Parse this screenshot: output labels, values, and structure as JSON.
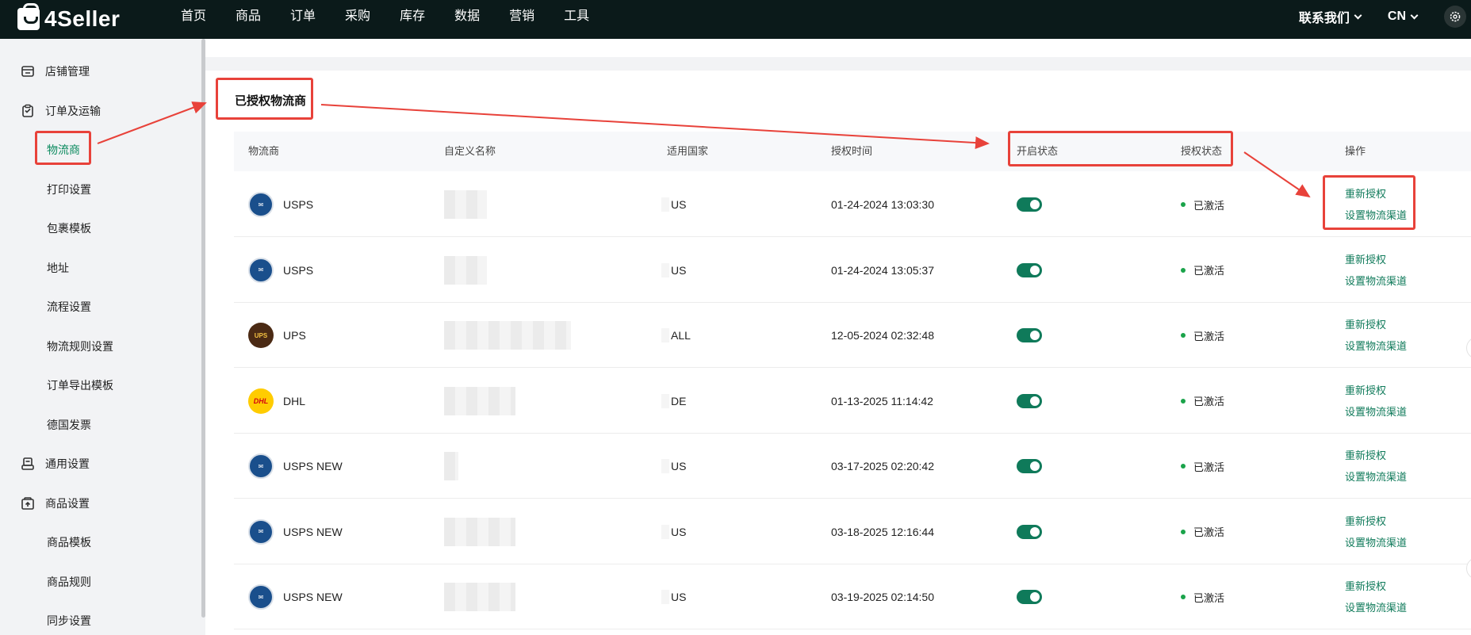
{
  "brand": {
    "name": "4Seller"
  },
  "topnav": {
    "items": [
      "首页",
      "商品",
      "订单",
      "采购",
      "库存",
      "数据",
      "营销",
      "工具"
    ],
    "contact": "联系我们",
    "language": "CN"
  },
  "sidebar": {
    "items": [
      {
        "label": "店铺管理",
        "level": "parent",
        "icon": "store-icon"
      },
      {
        "label": "订单及运输",
        "level": "parent",
        "icon": "clipboard-icon"
      },
      {
        "label": "物流商",
        "level": "child",
        "active": true
      },
      {
        "label": "打印设置",
        "level": "child"
      },
      {
        "label": "包裹模板",
        "level": "child"
      },
      {
        "label": "地址",
        "level": "child"
      },
      {
        "label": "流程设置",
        "level": "child"
      },
      {
        "label": "物流规则设置",
        "level": "child"
      },
      {
        "label": "订单导出模板",
        "level": "child"
      },
      {
        "label": "德国发票",
        "level": "child"
      },
      {
        "label": "通用设置",
        "level": "parent",
        "icon": "printer-icon"
      },
      {
        "label": "商品设置",
        "level": "parent",
        "icon": "upload-box-icon"
      },
      {
        "label": "商品模板",
        "level": "child"
      },
      {
        "label": "商品规则",
        "level": "child"
      },
      {
        "label": "同步设置",
        "level": "child"
      }
    ]
  },
  "main": {
    "section_title": "已授权物流商",
    "columns": [
      "物流商",
      "自定义名称",
      "适用国家",
      "授权时间",
      "开启状态",
      "授权状态",
      "操作"
    ],
    "rows": [
      {
        "carrier": "USPS",
        "logo": "usps-logo-icon",
        "country": "US",
        "time": "01-24-2024 13:03:30",
        "enabled": true,
        "status": "已激活"
      },
      {
        "carrier": "USPS",
        "logo": "usps-logo-icon",
        "country": "US",
        "time": "01-24-2024 13:05:37",
        "enabled": true,
        "status": "已激活"
      },
      {
        "carrier": "UPS",
        "logo": "ups-logo-icon",
        "country": "ALL",
        "time": "12-05-2024 02:32:48",
        "enabled": true,
        "status": "已激活"
      },
      {
        "carrier": "DHL",
        "logo": "dhl-logo-icon",
        "country": "DE",
        "time": "01-13-2025 11:14:42",
        "enabled": true,
        "status": "已激活"
      },
      {
        "carrier": "USPS NEW",
        "logo": "usps-logo-icon",
        "country": "US",
        "time": "03-17-2025 02:20:42",
        "enabled": true,
        "status": "已激活"
      },
      {
        "carrier": "USPS NEW",
        "logo": "usps-logo-icon",
        "country": "US",
        "time": "03-18-2025 12:16:44",
        "enabled": true,
        "status": "已激活"
      },
      {
        "carrier": "USPS NEW",
        "logo": "usps-logo-icon",
        "country": "US",
        "time": "03-19-2025 02:14:50",
        "enabled": true,
        "status": "已激活"
      }
    ],
    "actions": {
      "reauthorize": "重新授权",
      "set_channel": "设置物流渠道"
    }
  },
  "colors": {
    "accent": "#0f7a5a",
    "annotation": "#e8423a",
    "topbar": "#0b1a1a",
    "active_dot": "#1aa34a"
  }
}
